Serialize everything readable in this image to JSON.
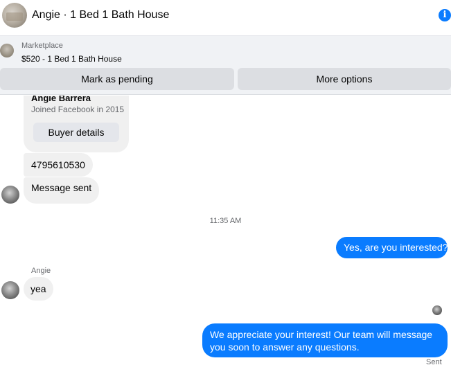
{
  "header": {
    "title": "Angie · 1 Bed 1 Bath House",
    "info_icon": "info-icon"
  },
  "marketplace": {
    "label": "Marketplace",
    "item": "$520 - 1 Bed 1 Bath House",
    "mark_pending_label": "Mark as pending",
    "more_options_label": "More options"
  },
  "buyer_card": {
    "name": "Angie Barrera",
    "joined": "Joined Facebook in 2015",
    "details_label": "Buyer details"
  },
  "messages": {
    "phone": "4795610530",
    "message_sent": "Message sent",
    "timestamp": "11:35 AM",
    "outgoing_1": "Yes, are you interested?",
    "sender_name": "Angie",
    "incoming_yea": "yea",
    "outgoing_2": "We appreciate your interest! Our team will message you soon to answer any questions.",
    "status": "Sent"
  },
  "colors": {
    "accent": "#0a7cff",
    "incoming_bubble": "#f0f0f0",
    "secondary_text": "#65676b"
  }
}
